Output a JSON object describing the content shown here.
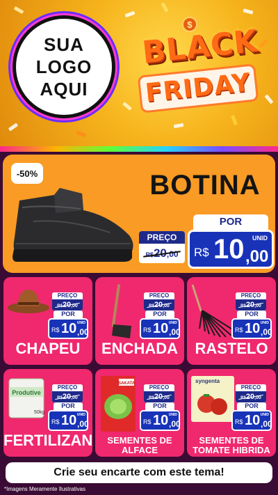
{
  "header": {
    "logo_line1": "SUA",
    "logo_line2": "LOGO",
    "logo_line3": "AQUI",
    "badge_symbol": "$",
    "black_word": "BLACK",
    "friday_word": "FRIDAY"
  },
  "colors": {
    "header_yellow": "#f6b31c",
    "main_orange": "#f99b24",
    "card_pink": "#f0286e",
    "price_blue": "#1833b8",
    "background": "#3a0b34"
  },
  "main_product": {
    "discount": "-50%",
    "title": "BOTINA",
    "old_label": "PREÇO",
    "old_currency": "R$",
    "old_int": "20",
    "old_dec": ",00",
    "new_label": "POR",
    "unid": "UNID",
    "new_currency": "R$",
    "new_int": "10",
    "new_dec": ",00",
    "icon": "boot-icon"
  },
  "products": [
    {
      "name": "CHAPEU",
      "icon": "hat-icon",
      "old_label": "PREÇO",
      "old_currency": "R$",
      "old_int": "20",
      "old_dec": ",00",
      "new_label": "POR",
      "unid": "UNID",
      "new_currency": "R$",
      "new_int": "10",
      "new_dec": ",00"
    },
    {
      "name": "ENCHADA",
      "icon": "hoe-icon",
      "old_label": "PREÇO",
      "old_currency": "R$",
      "old_int": "20",
      "old_dec": ",00",
      "new_label": "POR",
      "unid": "UNID",
      "new_currency": "R$",
      "new_int": "10",
      "new_dec": ",00"
    },
    {
      "name": "RASTELO",
      "icon": "rake-icon",
      "old_label": "PREÇO",
      "old_currency": "R$",
      "old_int": "20",
      "old_dec": ",00",
      "new_label": "POR",
      "unid": "UNID",
      "new_currency": "R$",
      "new_int": "10",
      "new_dec": ",00"
    },
    {
      "name": "FERTILIZANTES",
      "icon": "fertilizer-bag-icon",
      "old_label": "PREÇO",
      "old_currency": "R$",
      "old_int": "20",
      "old_dec": ",00",
      "new_label": "POR",
      "unid": "UNID",
      "new_currency": "R$",
      "new_int": "10",
      "new_dec": ",00"
    },
    {
      "name_line1": "SEMENTES DE",
      "name_line2": "ALFACE",
      "icon": "seed-packet-icon",
      "old_label": "PREÇO",
      "old_currency": "R$",
      "old_int": "20",
      "old_dec": ",00",
      "new_label": "POR",
      "unid": "UNID",
      "new_currency": "R$",
      "new_int": "10",
      "new_dec": ",00"
    },
    {
      "name_line1": "SEMENTES DE",
      "name_line2": "TOMATE HIBRIDA",
      "icon": "seed-packet-icon",
      "old_label": "PREÇO",
      "old_currency": "R$",
      "old_int": "20",
      "old_dec": ",00",
      "new_label": "POR",
      "unid": "UNID",
      "new_currency": "R$",
      "new_int": "10",
      "new_dec": ",00"
    }
  ],
  "packaging_text": {
    "fertilizer_brand": "Produtive",
    "fertilizer_weight": "50kg",
    "lettuce_brand": "SAKATA",
    "tomato_brand": "syngenta"
  },
  "footer": {
    "cta": "Crie seu encarte com este tema!",
    "disclaimer": "*Imagens Meramente Ilustrativas"
  }
}
